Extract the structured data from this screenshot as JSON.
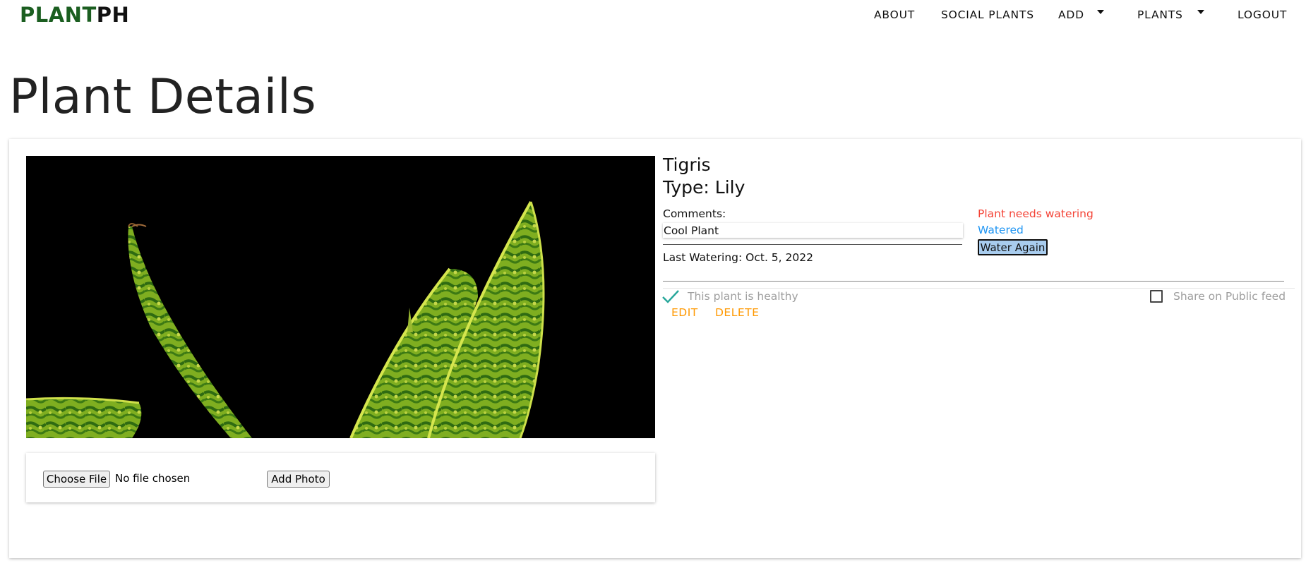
{
  "brand": {
    "part1": "PLANT",
    "part2": "PH",
    "color_primary": "#1b5e20"
  },
  "nav": {
    "about": "ABOUT",
    "social": "SOCIAL PLANTS",
    "add": "ADD",
    "plants": "PLANTS",
    "logout": "LOGOUT"
  },
  "page": {
    "title": "Plant Details"
  },
  "plant": {
    "name": "Tigris",
    "type": "Type: Lily",
    "comments_label": "Comments:",
    "comments_value": "Cool Plant",
    "last_watering": "Last Watering: Oct. 5, 2022",
    "needs_watering": "Plant needs watering",
    "watered_link": "Watered",
    "water_again": "Water Again",
    "healthy_label": "This plant is healthy",
    "healthy": true,
    "share_label": "Share on Public feed",
    "share": false,
    "photo_icon": "snake-plant-photo"
  },
  "upload": {
    "choose_file": "Choose File",
    "no_file": "No file chosen",
    "add_photo": "Add Photo"
  },
  "actions": {
    "edit": "EDIT",
    "delete": "DELETE"
  },
  "colors": {
    "warning": "#f44336",
    "link": "#2196f3",
    "action": "#ff9800",
    "check": "#26a69a",
    "water_button": "#a8ccee"
  }
}
